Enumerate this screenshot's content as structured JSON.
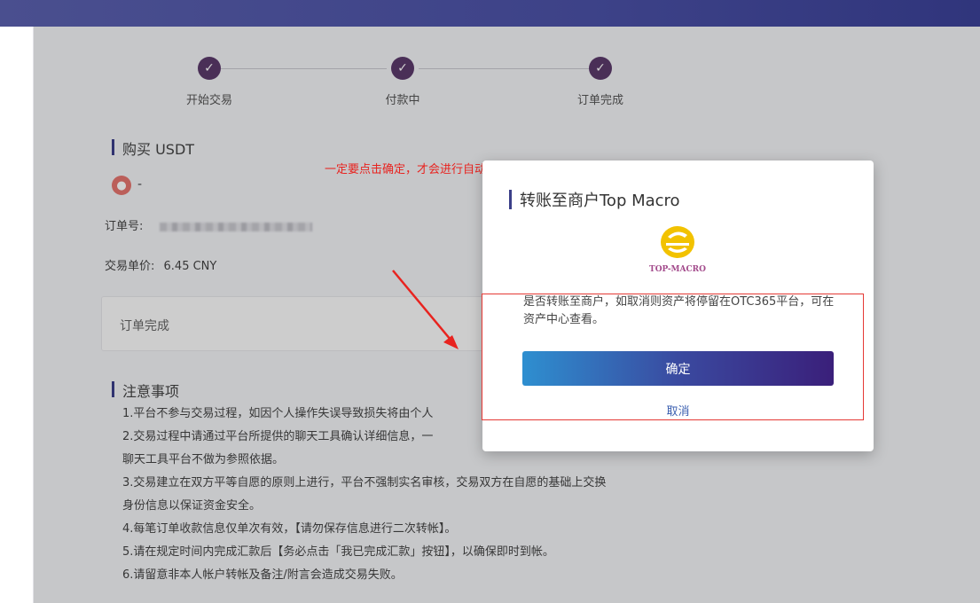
{
  "steps": [
    {
      "label": "开始交易"
    },
    {
      "label": "付款中"
    },
    {
      "label": "订单完成"
    }
  ],
  "purchase": {
    "title": "购买 USDT",
    "user_name": "-",
    "order_label": "订单号:",
    "price_label": "交易单价:",
    "price_value": "6.45 CNY",
    "status_card": "订单完成"
  },
  "notes": {
    "title": "注意事项",
    "lines": [
      "1.平台不参与交易过程，如因个人操作失误导致损失将由个人",
      "2.交易过程中请通过平台所提供的聊天工具确认详细信息，一",
      "聊天工具平台不做为参照依据。",
      "3.交易建立在双方平等自愿的原则上进行，平台不强制实名审核，交易双方在自愿的基础上交换",
      "身份信息以保证资金安全。",
      "4.每笔订单收款信息仅单次有效，【请勿保存信息进行二次转帐】。",
      "5.请在规定时间内完成汇款后【务必点击「我已完成汇款」按钮】，以确保即时到帐。",
      "6.请留意非本人帐户转帐及备注/附言会造成交易失败。"
    ]
  },
  "annotation": "一定要点击确定，才会进行自动回调",
  "modal": {
    "title": "转账至商户Top Macro",
    "logo_text": "TOP-MACRO",
    "message": "是否转账至商户，如取消则资产将停留在OTC365平台，可在资产中心查看。",
    "confirm_label": "确定",
    "cancel_label": "取消"
  },
  "colors": {
    "accent": "#3b3f89",
    "annotation": "#e8231f"
  }
}
